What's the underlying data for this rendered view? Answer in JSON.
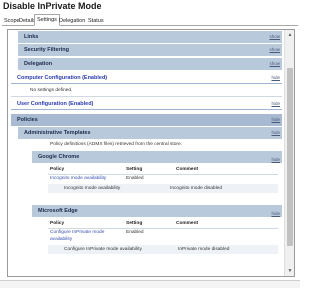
{
  "window": {
    "title": "Disable InPrivate Mode"
  },
  "tabs": [
    {
      "label": "Scope"
    },
    {
      "label": "Details"
    },
    {
      "label": "Settings"
    },
    {
      "label": "Delegation"
    },
    {
      "label": "Status"
    }
  ],
  "toggles": {
    "show": "show",
    "hide": "hide"
  },
  "report": {
    "links": "Links",
    "security_filtering": "Security Filtering",
    "delegation": "Delegation",
    "computer_config": "Computer Configuration (Enabled)",
    "computer_no_settings": "No settings defined.",
    "user_config": "User Configuration (Enabled)",
    "policies": "Policies",
    "admin_templates": "Administrative Templates",
    "admin_note": "Policy definitions (ADMX files) retrieved from the central store.",
    "google_chrome": {
      "header": "Google Chrome",
      "col_policy": "Policy",
      "col_setting": "Setting",
      "col_comment": "Comment",
      "row_policy": "Incognito mode availability",
      "row_setting": "Enabled",
      "row_detail_label": "Incognito mode availability",
      "row_detail_value": "Incognito mode disabled"
    },
    "microsoft_edge": {
      "header": "Microsoft Edge",
      "col_policy": "Policy",
      "col_setting": "Setting",
      "col_comment": "Comment",
      "row_policy_line1": "Configure InPrivate mode",
      "row_policy_line2": "availability",
      "row_setting": "Enabled",
      "row_detail_label": "Configure InPrivate mode availability",
      "row_detail_value": "InPrivate mode disabled"
    }
  }
}
